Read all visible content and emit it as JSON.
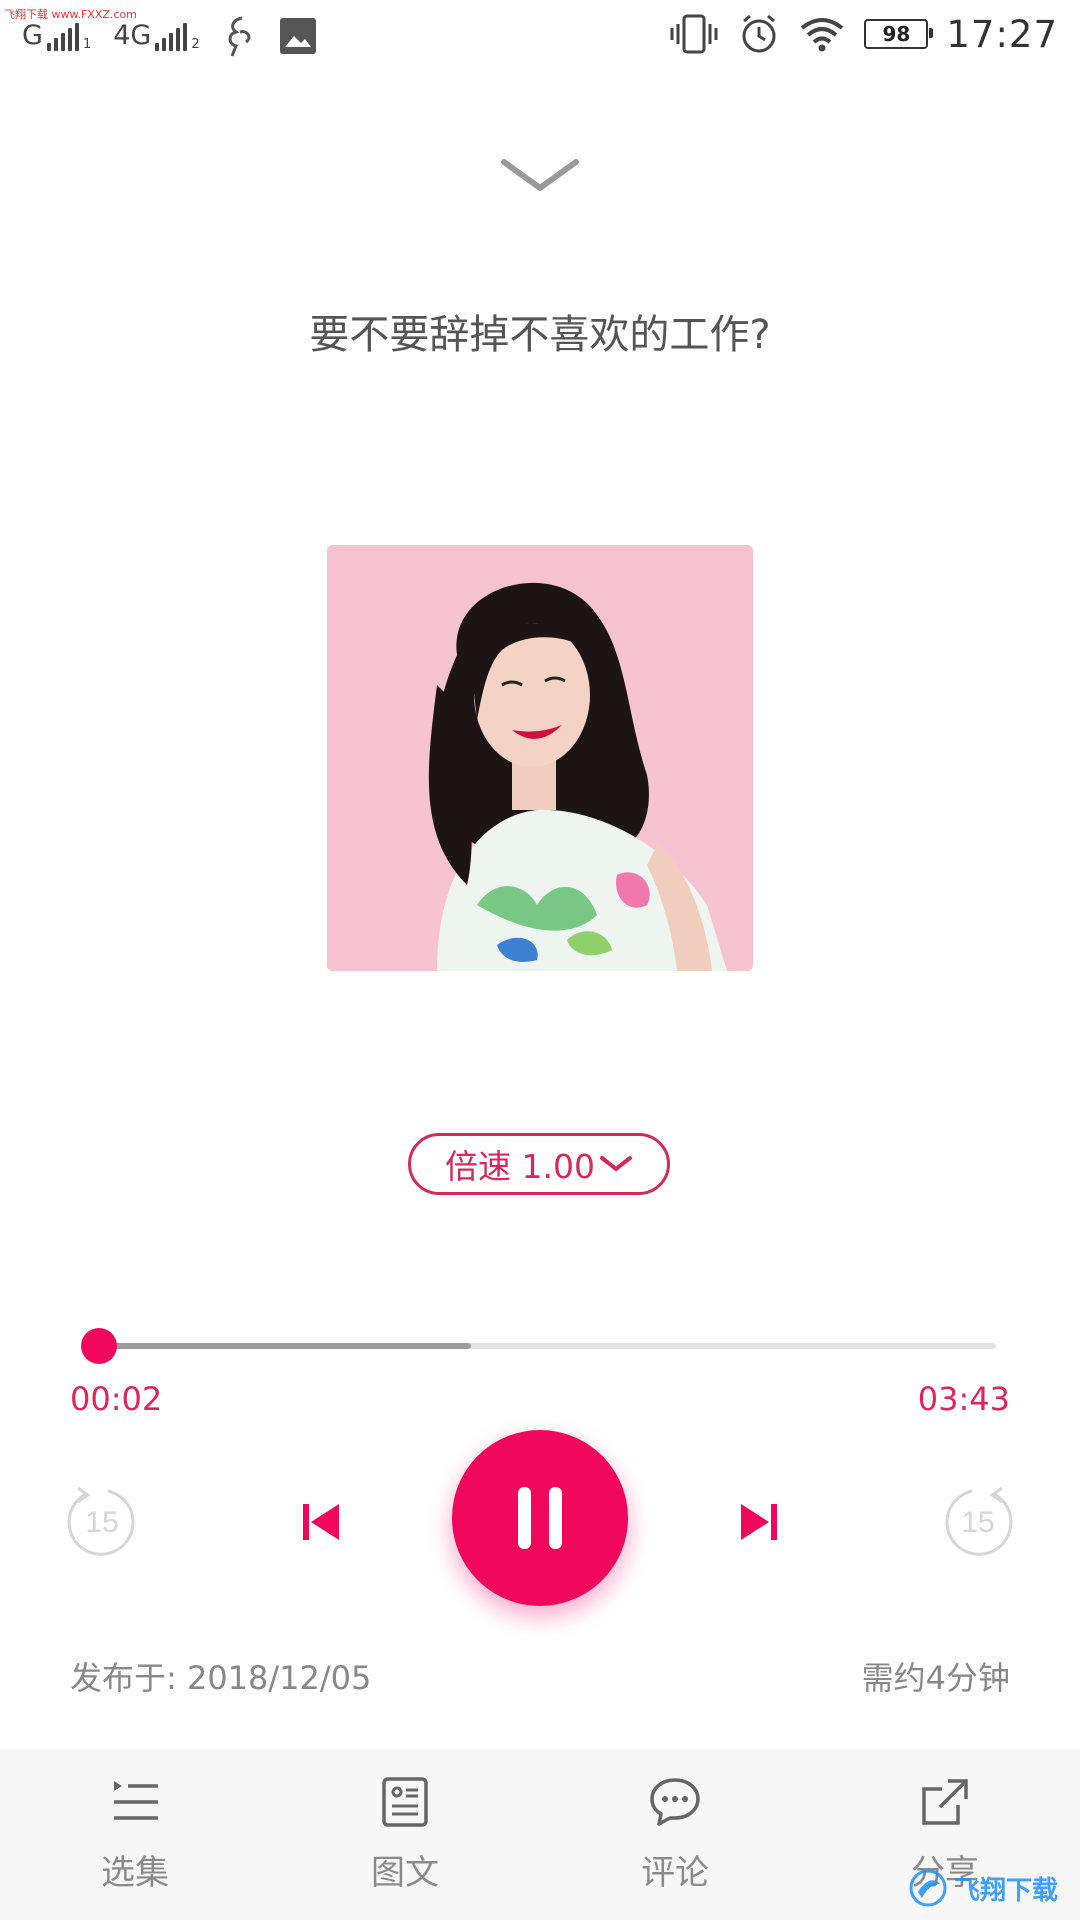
{
  "status_bar": {
    "watermark": "飞翔下载 www.FXXZ.com",
    "sim1_label": "G",
    "sim1_sub": "1",
    "sim2_label": "4G",
    "sim2_sub": "2",
    "battery": "98",
    "time": "17:27"
  },
  "player": {
    "title": "要不要辞掉不喜欢的工作?",
    "speed_label": "倍速 1.00",
    "current_time": "00:02",
    "total_time": "03:43",
    "progress_fraction": 0.01,
    "buffered_fraction": 0.42,
    "skip_back_seconds": "15",
    "skip_forward_seconds": "15",
    "publish_date": "发布于: 2018/12/05",
    "duration_text": "需约4分钟"
  },
  "colors": {
    "accent": "#f0075c",
    "speed_border": "#d42a5b",
    "muted_text": "#888888"
  },
  "tabs": [
    {
      "label": "选集",
      "icon": "playlist-icon"
    },
    {
      "label": "图文",
      "icon": "article-icon"
    },
    {
      "label": "评论",
      "icon": "comment-icon"
    },
    {
      "label": "分享",
      "icon": "share-icon"
    }
  ],
  "brand_watermark": "飞翔下载"
}
